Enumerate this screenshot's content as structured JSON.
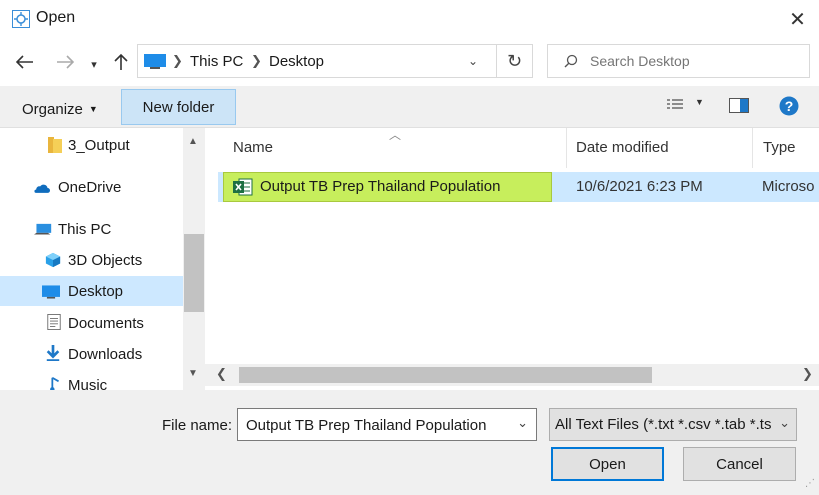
{
  "window": {
    "title": "Open"
  },
  "address": {
    "crumbs": [
      "This PC",
      "Desktop"
    ]
  },
  "search": {
    "placeholder": "Search Desktop"
  },
  "toolbar": {
    "organize_label": "Organize",
    "new_folder_label": "New folder"
  },
  "nav": {
    "items": [
      {
        "label": "3_Output",
        "icon": "folder-icon"
      },
      {
        "label": "OneDrive",
        "icon": "cloud-icon"
      },
      {
        "label": "This PC",
        "icon": "computer-icon"
      },
      {
        "label": "3D Objects",
        "icon": "cube-icon"
      },
      {
        "label": "Desktop",
        "icon": "desktop-icon",
        "selected": true
      },
      {
        "label": "Documents",
        "icon": "document-icon"
      },
      {
        "label": "Downloads",
        "icon": "download-icon"
      },
      {
        "label": "Music",
        "icon": "music-icon"
      }
    ]
  },
  "list": {
    "columns": [
      "Name",
      "Date modified",
      "Type"
    ],
    "rows": [
      {
        "name": "Output TB Prep Thailand Population",
        "date": "10/6/2021 6:23 PM",
        "type": "Microso",
        "icon": "excel-icon"
      }
    ]
  },
  "footer": {
    "file_name_label": "File name:",
    "file_name_value": "Output TB Prep Thailand Population",
    "file_type": "All Text Files (*.txt *.csv *.tab *.ts",
    "open_label": "Open",
    "cancel_label": "Cancel"
  },
  "colors": {
    "accent": "#0078d7",
    "selection": "#cce8ff",
    "highlight": "#c7ee5c"
  }
}
